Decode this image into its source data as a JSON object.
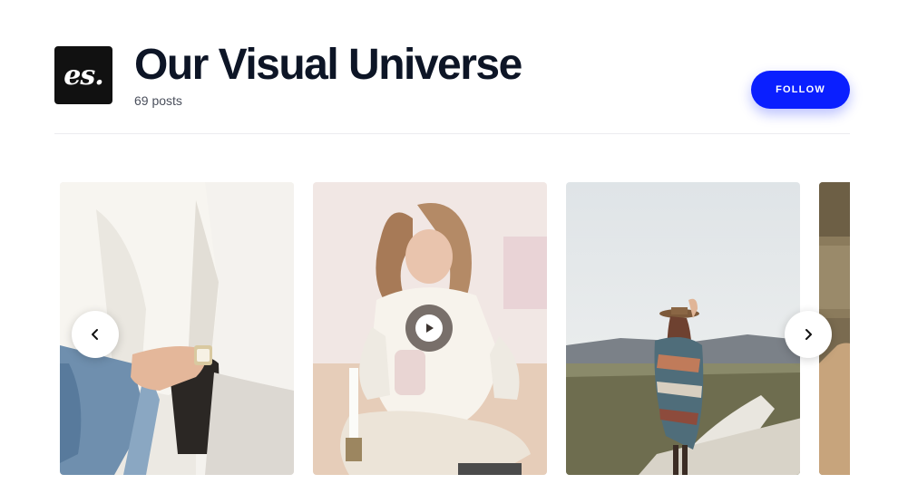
{
  "profile": {
    "logo_text": "es.",
    "title": "Our Visual Universe",
    "post_count": "69 posts"
  },
  "follow_button": {
    "label": "FOLLOW"
  },
  "carousel": {
    "posts": [
      {
        "subject": "woman in white shirt and jeans with watch",
        "type": "image"
      },
      {
        "subject": "woman in white knit sweater sitting on floor",
        "type": "video"
      },
      {
        "subject": "woman in hat and striped poncho on country road",
        "type": "image"
      },
      {
        "subject": "partially visible post",
        "type": "image"
      }
    ],
    "prev_icon": "chevron-left-icon",
    "next_icon": "chevron-right-icon",
    "play_icon": "play-icon"
  },
  "colors": {
    "accent": "#0a1fff",
    "title": "#0d1526",
    "logo_bg": "#111111"
  }
}
